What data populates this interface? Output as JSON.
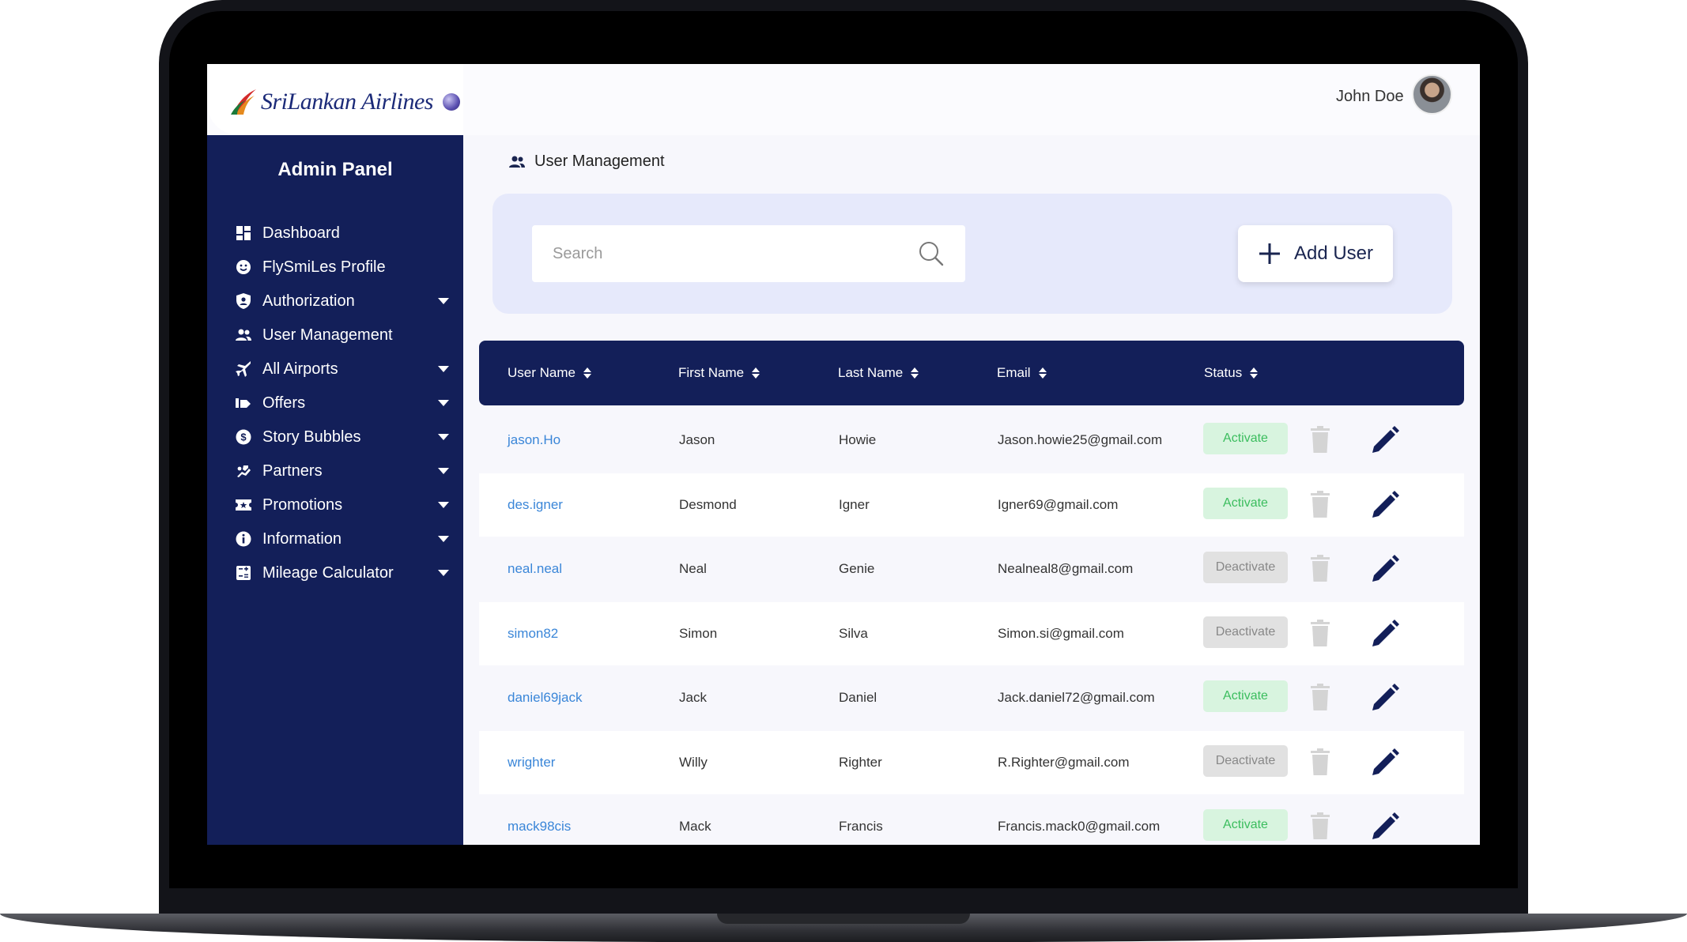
{
  "brand": {
    "logo_text": "SriLankan Airlines"
  },
  "header": {
    "user_name": "John Doe"
  },
  "sidebar": {
    "title": "Admin Panel",
    "items": [
      {
        "label": "Dashboard",
        "icon": "dashboard-icon",
        "has_caret": false
      },
      {
        "label": "FlySmiLes Profile",
        "icon": "smile-icon",
        "has_caret": false
      },
      {
        "label": "Authorization",
        "icon": "shield-user-icon",
        "has_caret": true
      },
      {
        "label": "User Management",
        "icon": "users-icon",
        "has_caret": false
      },
      {
        "label": "All Airports",
        "icon": "airplane-icon",
        "has_caret": true
      },
      {
        "label": "Offers",
        "icon": "tag-icon",
        "has_caret": true
      },
      {
        "label": "Story Bubbles",
        "icon": "dollar-icon",
        "has_caret": true
      },
      {
        "label": "Partners",
        "icon": "handshake-icon",
        "has_caret": true
      },
      {
        "label": "Promotions",
        "icon": "ticket-icon",
        "has_caret": true
      },
      {
        "label": "Information",
        "icon": "info-icon",
        "has_caret": true
      },
      {
        "label": "Mileage Calculator",
        "icon": "calculator-icon",
        "has_caret": true
      }
    ]
  },
  "main": {
    "title": "User Management",
    "search": {
      "placeholder": "Search",
      "value": ""
    },
    "add_user_label": "Add User"
  },
  "table": {
    "columns": [
      "User Name",
      "First Name",
      "Last Name",
      "Email",
      "Status"
    ],
    "rows": [
      {
        "username": "jason.Ho",
        "first": "Jason",
        "last": "Howie",
        "email": "Jason.howie25@gmail.com",
        "status": "Activate"
      },
      {
        "username": "des.igner",
        "first": "Desmond",
        "last": "Igner",
        "email": "Igner69@gmail.com",
        "status": "Activate"
      },
      {
        "username": "neal.neal",
        "first": "Neal",
        "last": "Genie",
        "email": "Nealneal8@gmail.com",
        "status": "Deactivate"
      },
      {
        "username": "simon82",
        "first": "Simon",
        "last": "Silva",
        "email": "Simon.si@gmail.com",
        "status": "Deactivate"
      },
      {
        "username": "daniel69jack",
        "first": "Jack",
        "last": "Daniel",
        "email": "Jack.daniel72@gmail.com",
        "status": "Activate"
      },
      {
        "username": "wrighter",
        "first": "Willy",
        "last": "Righter",
        "email": "R.Righter@gmail.com",
        "status": "Deactivate"
      },
      {
        "username": "mack98cis",
        "first": "Mack",
        "last": "Francis",
        "email": "Francis.mack0@gmail.com",
        "status": "Activate"
      }
    ]
  },
  "colors": {
    "navy": "#131f59",
    "panel": "#e6e9fb",
    "link": "#3a86d8",
    "activate_bg": "#d8f4df",
    "activate_text": "#3bbd5e",
    "deactivate_bg": "#e1e1e1",
    "deactivate_text": "#888888"
  }
}
